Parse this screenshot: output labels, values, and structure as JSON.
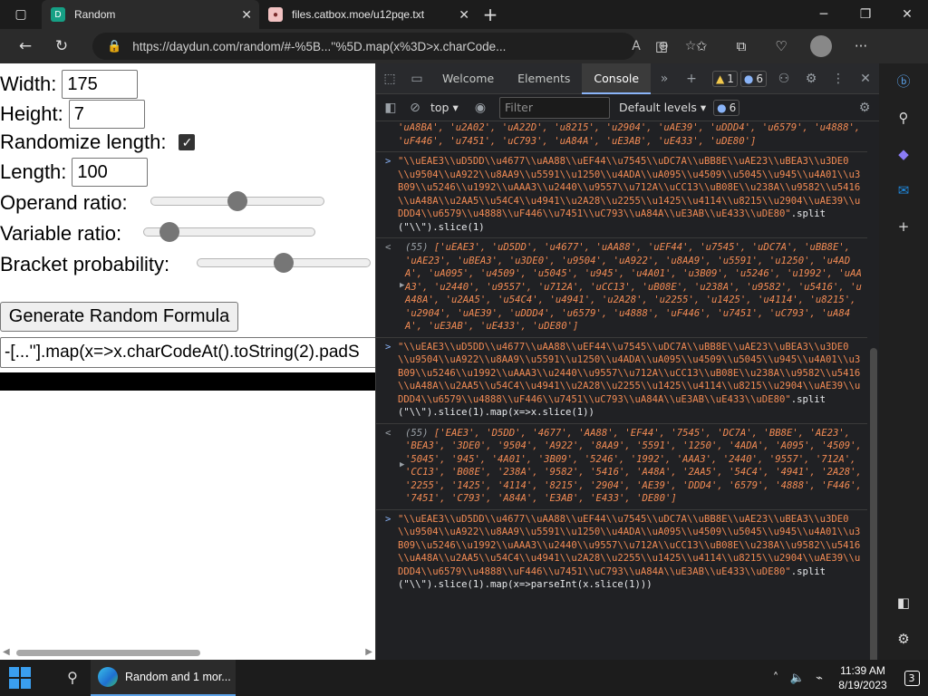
{
  "browser": {
    "tabs": [
      {
        "title": "Random",
        "favicon": "daydun-icon"
      },
      {
        "title": "files.catbox.moe/u12pqe.txt",
        "favicon": "catbox-icon"
      }
    ],
    "url": "https://daydun.com/random/#-%5B...''%5D.map(x%3D>x.charCode...",
    "new_tab": "+",
    "close_glyph": "✕"
  },
  "page": {
    "width_label": "Width:",
    "width_value": "175",
    "height_label": "Height:",
    "height_value": "7",
    "randomize_label": "Randomize length:",
    "randomize_checked": true,
    "length_label": "Length:",
    "length_value": "100",
    "operand_label": "Operand ratio:",
    "operand_value": 0.5,
    "variable_label": "Variable ratio:",
    "variable_value": 0.1,
    "bracket_label": "Bracket probability:",
    "bracket_value": 0.5,
    "generate_label": "Generate Random Formula",
    "output_value": "-[...''].map(x=>x.charCodeAt().toString(2).padS"
  },
  "devtools": {
    "tabs": [
      "Welcome",
      "Elements",
      "Console"
    ],
    "active_tab": "Console",
    "warn_count": "1",
    "info_count": "6",
    "context": "top",
    "filter_placeholder": "Filter",
    "levels": "Default levels",
    "levels_count": "6",
    "console": {
      "top_partial": "'uA8BA', 'u2A02', 'uA22D', 'u8215', 'u2904', 'uAE39', 'uDDD4', 'u6579', 'u4888', 'uF446', 'u7451', 'uC793', 'uA84A', 'uE3AB', 'uE433', 'uDE80']",
      "in1_str": "\"\\\\uEAE3\\\\uD5DD\\\\u4677\\\\uAA88\\\\uEF44\\\\u7545\\\\uDC7A\\\\uBB8E\\\\uAE23\\\\uBEA3\\\\u3DE0\\\\u9504\\\\uA922\\\\u8AA9\\\\u5591\\\\u1250\\\\u4ADA\\\\uA095\\\\u4509\\\\u5045\\\\u945\\\\u4A01\\\\u3B09\\\\u5246\\\\u1992\\\\uAAA3\\\\u2440\\\\u9557\\\\u712A\\\\uCC13\\\\uB08E\\\\u238A\\\\u9582\\\\u5416\\\\uA48A\\\\u2AA5\\\\u54C4\\\\u4941\\\\u2A28\\\\u2255\\\\u1425\\\\u4114\\\\u8215\\\\u2904\\\\uAE39\\\\uDDD4\\\\u6579\\\\u4888\\\\uF446\\\\u7451\\\\uC793\\\\uA84A\\\\uE3AB\\\\uE433\\\\uDE80\"",
      "in1_code": ".split(\"\\\\\").slice(1)",
      "out1_count": "(55) ",
      "out1": "['uEAE3', 'uD5DD', 'u4677', 'uAA88', 'uEF44', 'u7545', 'uDC7A', 'uBB8E', 'uAE23', 'uBEA3', 'u3DE0', 'u9504', 'uA922', 'u8AA9', 'u5591', 'u1250', 'u4ADA', 'uA095', 'u4509', 'u5045', 'u945', 'u4A01', 'u3B09', 'u5246', 'u1992', 'uAAA3', 'u2440', 'u9557', 'u712A', 'uCC13', 'uB08E', 'u238A', 'u9582', 'u5416', 'uA48A', 'u2AA5', 'u54C4', 'u4941', 'u2A28', 'u2255', 'u1425', 'u4114', 'u8215', 'u2904', 'uAE39', 'uDDD4', 'u6579', 'u4888', 'uF446', 'u7451', 'uC793', 'uA84A', 'uE3AB', 'uE433', 'uDE80']",
      "in2_code": ".split(\"\\\\\").slice(1).map(x=>x.slice(1))",
      "out2_count": "(55) ",
      "out2": "['EAE3', 'D5DD', '4677', 'AA88', 'EF44', '7545', 'DC7A', 'BB8E', 'AE23', 'BEA3', '3DE0', '9504', 'A922', '8AA9', '5591', '1250', '4ADA', 'A095', '4509', '5045', '945', '4A01', '3B09', '5246', '1992', 'AAA3', '2440', '9557', '712A', 'CC13', 'B08E', '238A', '9582', '5416', 'A48A', '2AA5', '54C4', '4941', '2A28', '2255', '1425', '4114', '8215', '2904', 'AE39', 'DDD4', '6579', '4888', 'F446', '7451', 'C793', 'A84A', 'E3AB', 'E433', 'DE80']",
      "in3_code": ".split(\"\\\\\").slice(1).map(x=>parseInt(x.slice(1)))"
    }
  },
  "taskbar": {
    "edge_label": "Random and 1 mor...",
    "time": "11:39 AM",
    "date": "8/19/2023",
    "notifications": "3"
  }
}
